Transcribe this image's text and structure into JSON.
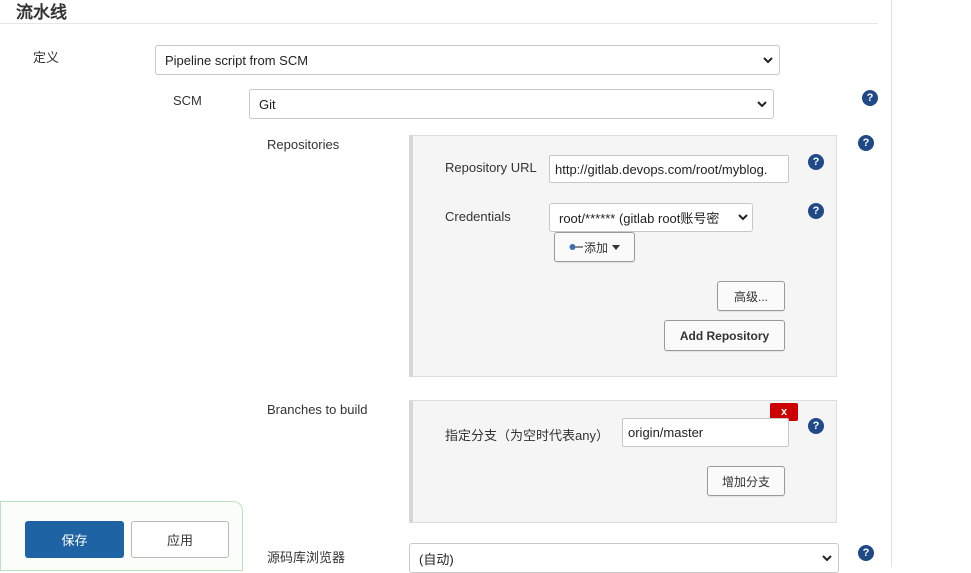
{
  "section": {
    "title": "流水线"
  },
  "definition": {
    "label": "定义",
    "value": "Pipeline script from SCM"
  },
  "scm": {
    "label": "SCM",
    "value": "Git"
  },
  "repositories": {
    "label": "Repositories",
    "url_label": "Repository URL",
    "url_value": "http://gitlab.devops.com/root/myblog.",
    "credentials_label": "Credentials",
    "credentials_value": "root/****** (gitlab root账号密",
    "add_label": "添加",
    "advanced_label": "高级...",
    "add_repository_label": "Add Repository"
  },
  "branches": {
    "label": "Branches to build",
    "delete_label": "x",
    "spec_label": "指定分支（为空时代表any）",
    "spec_value": "origin/master",
    "add_branch_label": "增加分支"
  },
  "browser": {
    "label": "源码库浏览器",
    "value": "(自动)"
  },
  "footer": {
    "save_label": "保存",
    "apply_label": "应用"
  },
  "colors": {
    "primary": "#1e63a4",
    "help": "#204a87",
    "danger": "#cc0000"
  }
}
